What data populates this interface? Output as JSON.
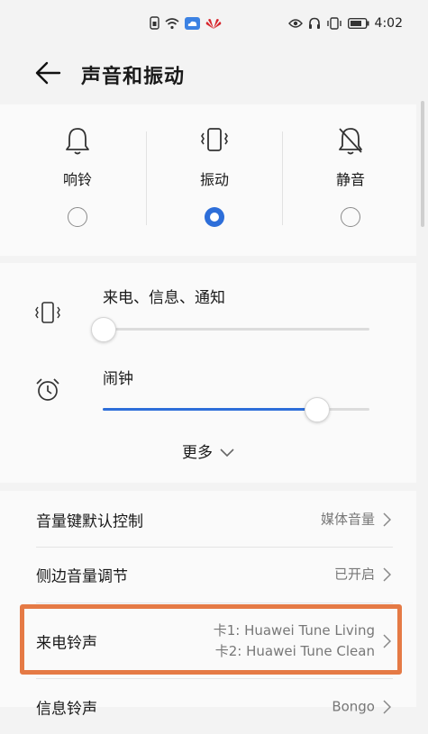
{
  "status_bar": {
    "time": "4:02"
  },
  "header": {
    "title": "声音和振动"
  },
  "modes": [
    {
      "label": "响铃",
      "icon": "bell-icon",
      "selected": false
    },
    {
      "label": "振动",
      "icon": "vibrate-icon",
      "selected": true
    },
    {
      "label": "静音",
      "icon": "bell-off-icon",
      "selected": false
    }
  ],
  "sliders": [
    {
      "label": "来电、信息、通知",
      "icon": "vibrate-icon",
      "level": 0.0
    },
    {
      "label": "闹钟",
      "icon": "alarm-clock-icon",
      "level": 0.8
    }
  ],
  "more": {
    "label": "更多"
  },
  "settings": [
    {
      "label": "音量键默认控制",
      "value": "媒体音量"
    },
    {
      "label": "侧边音量调节",
      "value": "已开启"
    },
    {
      "label": "来电铃声",
      "value_line1": "卡1: Huawei Tune Living",
      "value_line2": "卡2: Huawei Tune Clean"
    },
    {
      "label": "信息铃声",
      "value": "Bongo"
    }
  ],
  "colors": {
    "accent": "#2d6ed9",
    "highlight": "#e57a45"
  }
}
